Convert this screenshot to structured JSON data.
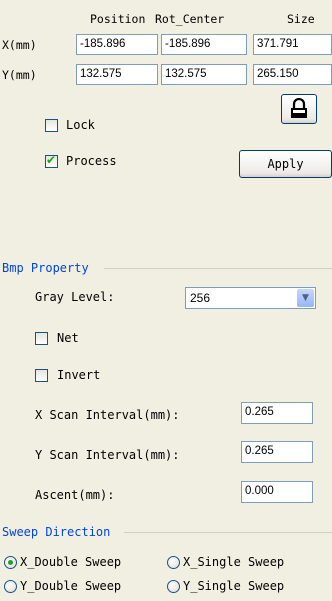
{
  "header": {
    "col_position": "Position",
    "col_rot_center": "Rot_Center",
    "col_size": "Size"
  },
  "rows": {
    "x": {
      "label": "X(mm)",
      "position": "-185.896",
      "rot_center": "-185.896",
      "size": "371.791"
    },
    "y": {
      "label": "Y(mm)",
      "position": "132.575",
      "rot_center": "132.575",
      "size": "265.150"
    }
  },
  "lock": {
    "label": "Lock",
    "checked": false,
    "icon": "padlock-icon"
  },
  "process": {
    "label": "Process",
    "checked": true
  },
  "apply_button": "Apply",
  "bmp": {
    "title": "Bmp Property",
    "gray_label": "Gray Level:",
    "gray_value": "256",
    "net_label": "Net",
    "invert_label": "Invert",
    "x_scan_label": "X Scan Interval(mm):",
    "x_scan_value": "0.265",
    "y_scan_label": "Y Scan Interval(mm):",
    "y_scan_value": "0.265",
    "ascent_label": "Ascent(mm):",
    "ascent_value": "0.000"
  },
  "sweep": {
    "title": "Sweep Direction",
    "options": [
      "X_Double Sweep",
      "X_Single Sweep",
      "Y_Double Sweep",
      "Y_Single Sweep"
    ],
    "selected": "X_Double Sweep"
  },
  "colors": {
    "group_title": "#0046d5",
    "background": "#f1efe2",
    "check": "#21a121"
  }
}
